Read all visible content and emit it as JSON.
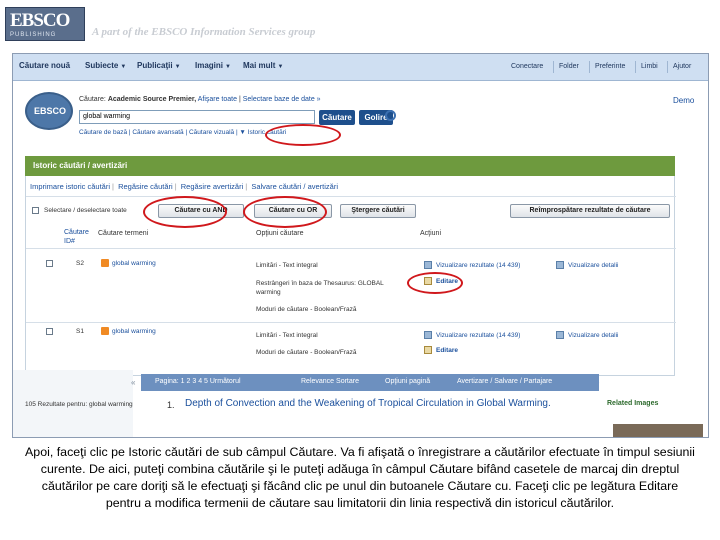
{
  "banner": {
    "logo_main": "EBSCO",
    "logo_sub": "PUBLISHING",
    "tagline": "A part of the EBSCO Information Services group"
  },
  "nav": {
    "items": [
      "Căutare nouă",
      "Subiecte",
      "Publicaţii",
      "Imagini",
      "Mai mult"
    ],
    "right_items": [
      "Conectare",
      "Folder",
      "Preferinte",
      "Limbi",
      "Ajutor"
    ]
  },
  "search": {
    "logo_text": "EBSCO",
    "search_in_label": "Căutare:",
    "database": "Academic Source Premier,",
    "show_all": "Afişare toate",
    "select_db": "Selectare baze de date »",
    "query": "global warming",
    "search_button": "Căutare",
    "clear_button": "Golire",
    "links": "Căutare de bază  |  Căutare avansată  |  Căutare vizuală  |  ▼ Istoric căutări",
    "demo_link": "Demo"
  },
  "history": {
    "header": "Istoric căutări / avertizări",
    "tabs": [
      "Imprimare istoric căutări",
      "Regăsire căutări",
      "Regăsire avertizări",
      "Salvare căutări / avertizări"
    ],
    "select_all_label": "Selectare / deselectare toate",
    "btn_and": "Căutare cu AND",
    "btn_or": "Căutare cu OR",
    "btn_delete": "Ştergere căutări",
    "btn_refresh": "Reîmprospătare rezultate de căutare",
    "col_id": "Căutare ID#",
    "col_terms": "Căutare termeni",
    "col_options": "Opţiuni căutare",
    "col_actions": "Acţiuni",
    "rows": [
      {
        "id": "S2",
        "term": "global warming",
        "options": [
          "Limitări - Text integral",
          "Restrângeri în baza de Thesaurus: GLOBAL warming",
          "Moduri de căutare - Boolean/Frază"
        ],
        "actions": [
          "Vizualizare rezultate (14 439)",
          "Vizualizare detalii",
          "Editare"
        ]
      },
      {
        "id": "S1",
        "term": "global warming",
        "options": [
          "Limitări - Text integral",
          "Moduri de căutare - Boolean/Frază"
        ],
        "actions": [
          "Vizualizare rezultate (14 439)",
          "Vizualizare detalii",
          "Editare"
        ]
      }
    ]
  },
  "results": {
    "left_title": "105 Rezultate pentru: global warming",
    "nav": [
      "Pagina: 1 2 3 4 5 Următorul",
      "Relevance Sortare",
      "Opţiuni pagină",
      "Avertizare / Salvare / Partajare"
    ],
    "first_num": "1.",
    "first_title": "Depth of Convection and the Weakening of Tropical Circulation in Global Warming.",
    "related": "Related Images"
  },
  "caption": "Apoi, faceţi clic pe Istoric căutări de sub câmpul Căutare. Va fi afişată o înregistrare a căutărilor efectuate în timpul sesiunii curente. De aici, puteţi combina căutările şi le puteţi adăuga în câmpul Căutare bifând casetele de marcaj din dreptul căutărilor pe care doriţi să le efectuaţi şi făcând clic pe unul din butoanele Căutare cu. Faceţi clic pe legătura Editare pentru a modifica termenii de căutare sau limitatorii din linia respectivă din istoricul căutărilor.",
  "colors": {
    "nav_bg": "#cfdff2",
    "history_header": "#6e9a3e",
    "button_blue": "#1e4f8c",
    "annotation_red": "#d0181c"
  }
}
